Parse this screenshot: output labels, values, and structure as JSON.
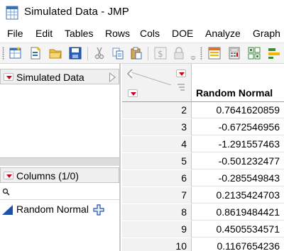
{
  "window": {
    "title": "Simulated Data - JMP"
  },
  "menu": [
    "File",
    "Edit",
    "Tables",
    "Rows",
    "Cols",
    "DOE",
    "Analyze",
    "Graph"
  ],
  "left_panel": {
    "table_name": "Simulated Data",
    "columns_header": "Columns (1/0)",
    "columns": [
      {
        "name": "Random Normal",
        "modeling_type": "continuous-icon",
        "role_icon": "formula-plus-icon"
      }
    ]
  },
  "grid": {
    "column_header": "Random Normal",
    "rows": [
      {
        "num": "2",
        "value": "0.7641620859"
      },
      {
        "num": "3",
        "value": "-0.672546956"
      },
      {
        "num": "4",
        "value": "-1.291557463"
      },
      {
        "num": "5",
        "value": "-0.501232477"
      },
      {
        "num": "6",
        "value": "-0.285549843"
      },
      {
        "num": "7",
        "value": "0.2135424703"
      },
      {
        "num": "8",
        "value": "0.8619484421"
      },
      {
        "num": "9",
        "value": "0.4505534571"
      },
      {
        "num": "10",
        "value": "0.1167654236"
      }
    ]
  },
  "colors": {
    "hot_spot_red": "#d0021b",
    "continuous_blue": "#1f4fa8"
  }
}
